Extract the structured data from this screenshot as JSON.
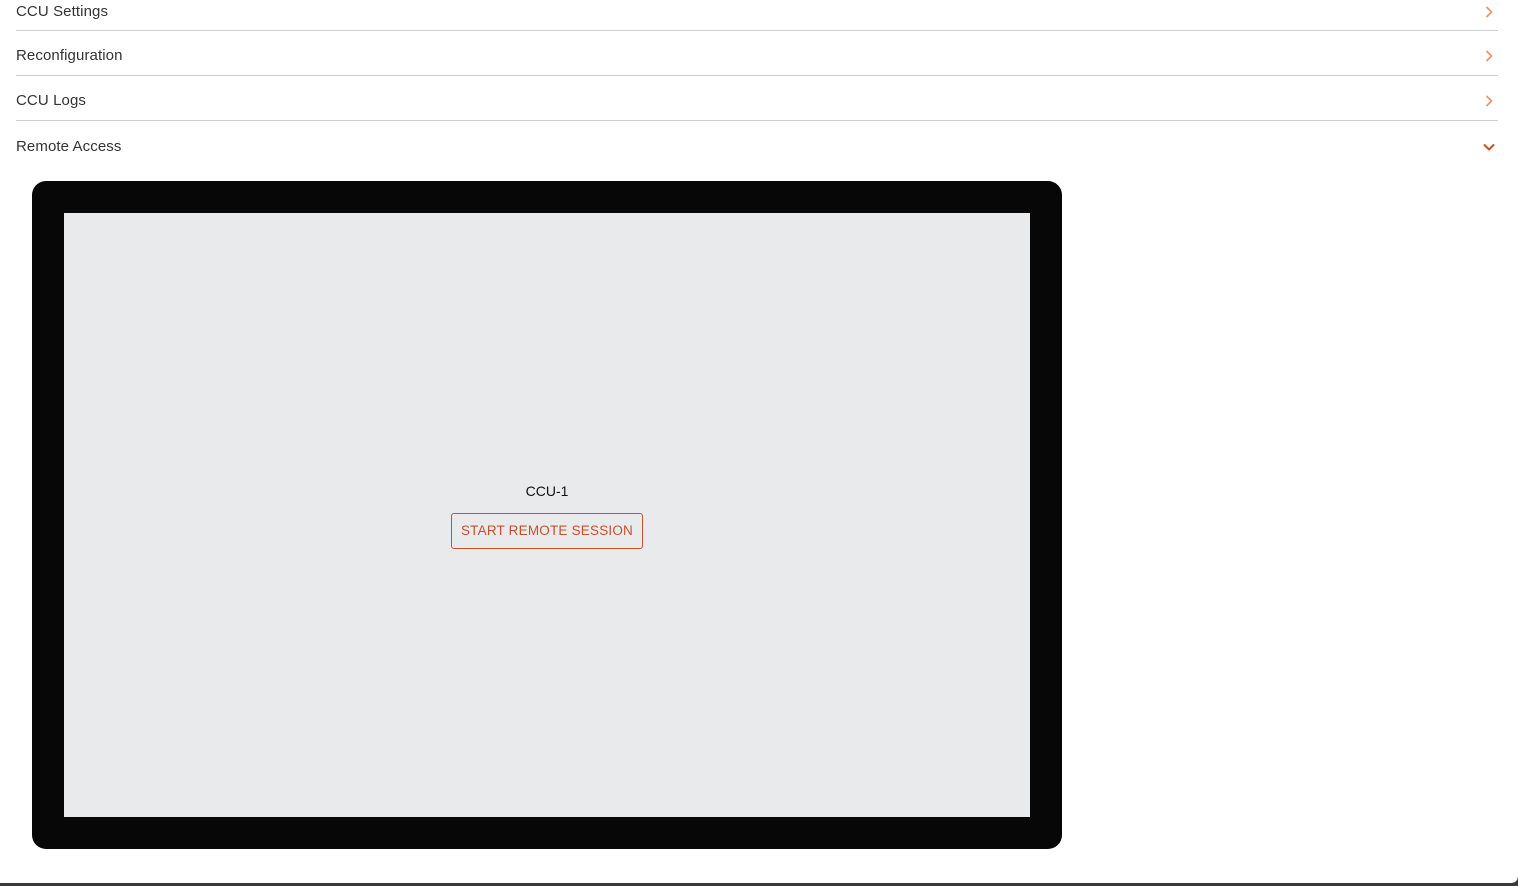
{
  "accordion": {
    "items": [
      {
        "label": "CCU Settings",
        "state": "collapsed",
        "icon": "chevron-right-icon"
      },
      {
        "label": "Reconfiguration",
        "state": "collapsed",
        "icon": "chevron-right-icon"
      },
      {
        "label": "CCU Logs",
        "state": "collapsed",
        "icon": "chevron-right-icon"
      },
      {
        "label": "Remote Access",
        "state": "expanded",
        "icon": "chevron-down-icon"
      }
    ]
  },
  "remote_access": {
    "device_name": "CCU-1",
    "start_button_label": "START REMOTE SESSION"
  },
  "colors": {
    "accent": "#c8502a",
    "chevron_collapsed": "#e8956f",
    "chevron_expanded": "#c8502a",
    "frame": "#070707",
    "screen": "#e9eaec",
    "divider": "#cfcfcf"
  }
}
